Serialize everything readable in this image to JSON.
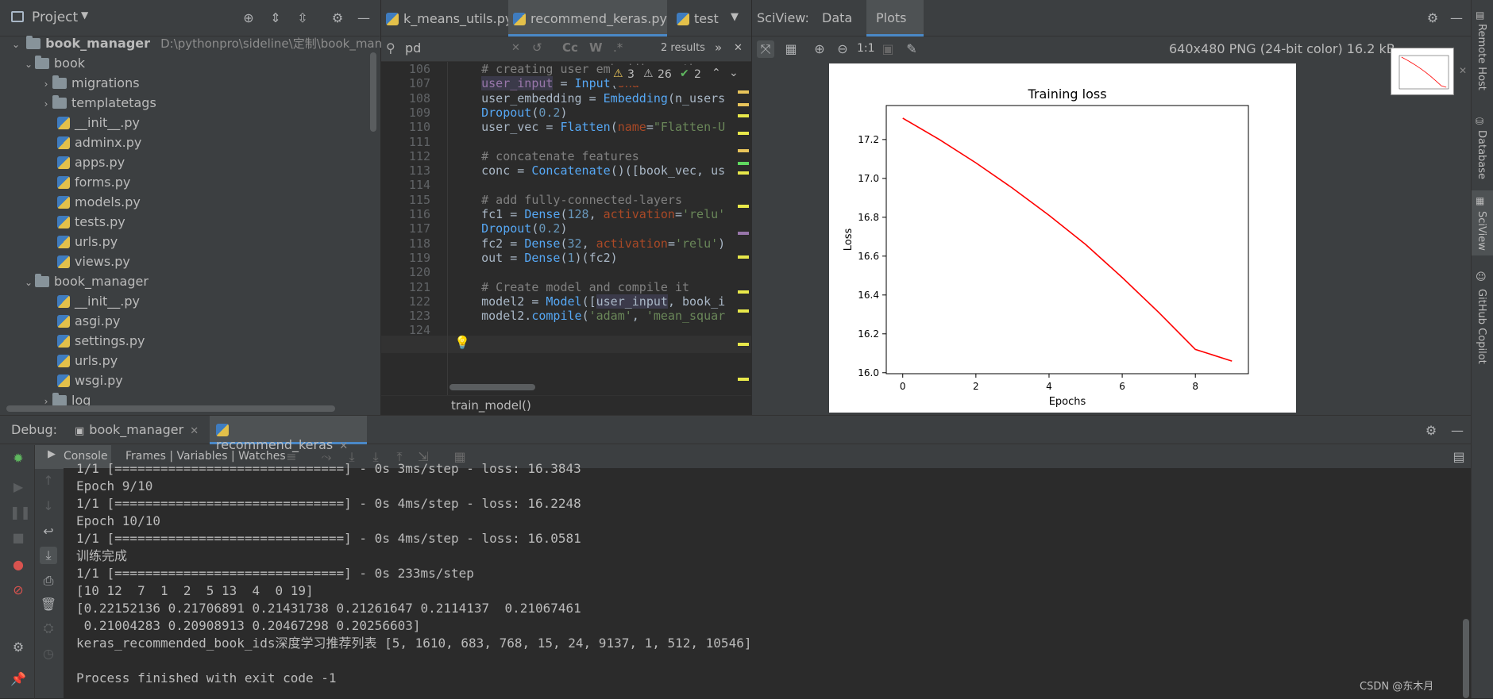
{
  "project": {
    "title": "Project",
    "root": {
      "name": "book_manager",
      "path": "D:\\pythonpro\\sideline\\定制\\book_manag"
    },
    "items": [
      {
        "label": "book",
        "type": "folder",
        "level": 1,
        "open": true
      },
      {
        "label": "migrations",
        "type": "folder",
        "level": 2,
        "open": false
      },
      {
        "label": "templatetags",
        "type": "folder",
        "level": 2,
        "open": false
      },
      {
        "label": "__init__.py",
        "type": "py",
        "level": 3
      },
      {
        "label": "adminx.py",
        "type": "py",
        "level": 3
      },
      {
        "label": "apps.py",
        "type": "py",
        "level": 3
      },
      {
        "label": "forms.py",
        "type": "py",
        "level": 3
      },
      {
        "label": "models.py",
        "type": "py",
        "level": 3
      },
      {
        "label": "tests.py",
        "type": "py",
        "level": 3
      },
      {
        "label": "urls.py",
        "type": "py",
        "level": 3
      },
      {
        "label": "views.py",
        "type": "py",
        "level": 3
      },
      {
        "label": "book_manager",
        "type": "folder",
        "level": 1,
        "open": true
      },
      {
        "label": "__init__.py",
        "type": "py",
        "level": 3
      },
      {
        "label": "asgi.py",
        "type": "py",
        "level": 3
      },
      {
        "label": "settings.py",
        "type": "py",
        "level": 3
      },
      {
        "label": "urls.py",
        "type": "py",
        "level": 3
      },
      {
        "label": "wsgi.py",
        "type": "py",
        "level": 3
      },
      {
        "label": "log",
        "type": "folder",
        "level": 2,
        "open": false
      }
    ]
  },
  "editor": {
    "tabs": [
      {
        "label": "k_means_utils.py",
        "active": false
      },
      {
        "label": "recommend_keras.py",
        "active": true
      },
      {
        "label": "test",
        "active": false
      }
    ],
    "search": {
      "value": "pd",
      "results": "2 results"
    },
    "inspections": {
      "warnings": "3",
      "weak_warnings": "26",
      "ok": "2"
    },
    "breadcrumb": "train_model()",
    "lines": [
      {
        "n": "106",
        "html": "<span class='cm'>    # creating user embedding path</span>"
      },
      {
        "n": "107",
        "html": "    <span class='pur' style='background:#3b3a4a'>user_input</span> = <span class='fn'>Input</span>(<span class='prm'>sha</span>"
      },
      {
        "n": "108",
        "html": "    user_embedding = <span class='fn'>Embedding</span>(n_users"
      },
      {
        "n": "109",
        "html": "    <span class='fn'>Dropout</span>(<span class='num'>0.2</span>)"
      },
      {
        "n": "110",
        "html": "    user_vec = <span class='fn'>Flatten</span>(<span class='prm'>name</span>=<span class='str'>\"Flatten-U</span>"
      },
      {
        "n": "111",
        "html": ""
      },
      {
        "n": "112",
        "html": "<span class='cm'>    # concatenate features</span>"
      },
      {
        "n": "113",
        "html": "    conc = <span class='fn'>Concatenate</span>()([book_vec, us"
      },
      {
        "n": "114",
        "html": ""
      },
      {
        "n": "115",
        "html": "<span class='cm'>    # add fully-connected-layers</span>"
      },
      {
        "n": "116",
        "html": "    fc1 = <span class='fn'>Dense</span>(<span class='num'>128</span>, <span class='prm'>activation</span>=<span class='str'>'relu'</span>"
      },
      {
        "n": "117",
        "html": "    <span class='fn'>Dropout</span>(<span class='num'>0.2</span>)"
      },
      {
        "n": "118",
        "html": "    fc2 = <span class='fn'>Dense</span>(<span class='num'>32</span>, <span class='prm'>activation</span>=<span class='str'>'relu'</span>)"
      },
      {
        "n": "119",
        "html": "    out = <span class='fn'>Dense</span>(<span class='num'>1</span>)(fc2)"
      },
      {
        "n": "120",
        "html": ""
      },
      {
        "n": "121",
        "html": "<span class='cm'>    # Create model and compile it</span>"
      },
      {
        "n": "122",
        "html": "    model2 = <span class='fn'>Model</span>([<span style='background:#3b3a4a'>user_input</span>, book_i"
      },
      {
        "n": "123",
        "html": "    model2.<span class='fn'>compile</span>(<span class='str'>'adam'</span>, <span class='str'>'mean_squar</span>"
      },
      {
        "n": "124",
        "html": ""
      }
    ]
  },
  "sciview": {
    "title": "SciView:",
    "tabs": [
      "Data",
      "Plots"
    ],
    "active_tab": "Plots",
    "zoom_label": "1:1",
    "image_info": "640x480 PNG (24-bit color) 16.2 kB"
  },
  "chart_data": {
    "type": "line",
    "title": "Training loss",
    "xlabel": "Epochs",
    "ylabel": "Loss",
    "x": [
      0,
      1,
      2,
      3,
      4,
      5,
      6,
      7,
      8,
      9
    ],
    "series": [
      {
        "values": [
          17.31,
          17.2,
          17.08,
          16.95,
          16.81,
          16.66,
          16.49,
          16.31,
          16.12,
          16.06
        ],
        "color": "#ff0000"
      }
    ],
    "xticks": [
      "0",
      "2",
      "4",
      "6",
      "8"
    ],
    "yticks": [
      "16.0",
      "16.2",
      "16.4",
      "16.6",
      "16.8",
      "17.0",
      "17.2"
    ],
    "xlim": [
      -0.45,
      9.45
    ],
    "ylim": [
      15.995,
      17.375
    ]
  },
  "debug": {
    "label": "Debug:",
    "tabs": [
      {
        "label": "book_manager",
        "active": false
      },
      {
        "label": "recommend_keras",
        "active": true
      }
    ],
    "console_tab": "Console",
    "frames_tab": "Frames | Variables | Watches",
    "console_lines": [
      "1/1 [==============================] - 0s 3ms/step - loss: 16.3843",
      "Epoch 9/10",
      "1/1 [==============================] - 0s 4ms/step - loss: 16.2248",
      "Epoch 10/10",
      "1/1 [==============================] - 0s 4ms/step - loss: 16.0581",
      "训练完成",
      "1/1 [==============================] - 0s 233ms/step",
      "[10 12  7  1  2  5 13  4  0 19]",
      "[0.22152136 0.21706891 0.21431738 0.21261647 0.2114137  0.21067461",
      " 0.21004283 0.20908913 0.20467298 0.20256603]",
      "keras_recommended_book_ids深度学习推荐列表 [5, 1610, 683, 768, 15, 24, 9137, 1, 512, 10546]",
      "",
      "Process finished with exit code -1"
    ]
  },
  "right_bar": [
    "Remote Host",
    "Database",
    "SciView",
    "GitHub Copilot"
  ],
  "watermark": "CSDN @东木月"
}
